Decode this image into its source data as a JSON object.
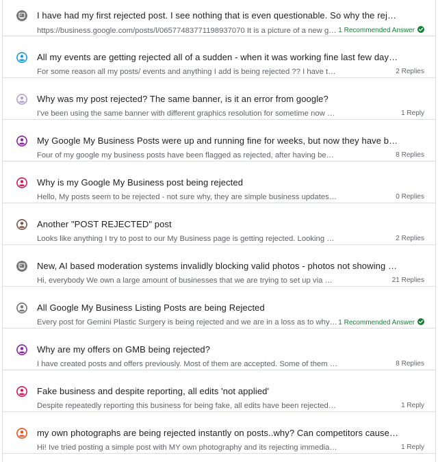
{
  "threads": [
    {
      "title": "I have had my first rejected post. I see nothing that is even questionable. So why the rejection?",
      "snippet": "https://business.google.com/posts/l/06577483771198937070 It is a picture of a new grill we offer at our restaurant",
      "meta": "1 Recommended Answer",
      "recommended": true,
      "avatar_color": "#757575",
      "avatar_type": "default"
    },
    {
      "title": "All my events are getting rejected all of a sudden - when it was working fine last few days ?? Why",
      "snippet": "For some reason all my posts/ events and anything I add is being rejected ?? I have tried many different things",
      "meta": "2 Replies",
      "recommended": false,
      "avatar_color": "#1a9ce0",
      "avatar_type": "person"
    },
    {
      "title": "Why was my post rejected? The same banner, is it an error from google?",
      "snippet": "I've been using the same banner with different graphics resolution for sometime now and size but it gets rejected",
      "meta": "1 Reply",
      "recommended": false,
      "avatar_color": "#b39ddb",
      "avatar_type": "person"
    },
    {
      "title": "My Google My Business Posts were up and running fine for weeks, but now they have been rejected",
      "snippet": "Four of my google my business posts have been flagged as rejected, after having been up for months now",
      "meta": "8 Replies",
      "recommended": false,
      "avatar_color": "#8e24aa",
      "avatar_type": "person"
    },
    {
      "title": "Why is my Google My Business post being rejected",
      "snippet": "Hello, My posts seem to be rejected - not sure why, they are simple business updates. Please help me understand",
      "meta": "0 Replies",
      "recommended": false,
      "avatar_color": "#d81b60",
      "avatar_type": "person"
    },
    {
      "title": "Another \"POST REJECTED\" post",
      "snippet": "Looks like anything I try to post to our My Business page is getting rejected. Looking at help on the subject",
      "meta": "2 Replies",
      "recommended": false,
      "avatar_color": "#795548",
      "avatar_type": "person"
    },
    {
      "title": "New, AI based moderation systems invalidly blocking valid photos - photos not showing up problem",
      "snippet": "Hi, everybody We own a large amount of businesses that we are trying to set up via Google and the photos",
      "meta": "21 Replies",
      "recommended": false,
      "avatar_color": "#757575",
      "avatar_type": "default"
    },
    {
      "title": "All Google My Business Listing Posts are being Rejected",
      "snippet": "Every post for Gemini Plastic Surgery is being rejected and we are in a loss as to why this is happening",
      "meta": "1 Recommended Answer",
      "recommended": true,
      "avatar_color": "#757575",
      "avatar_type": "person"
    },
    {
      "title": "Why are my offers on GMB being rejected?",
      "snippet": "I have created posts and offers previously. Most of them are accepted. Some of them get rejected without reason",
      "meta": "8 Replies",
      "recommended": false,
      "avatar_color": "#8e24aa",
      "avatar_type": "person"
    },
    {
      "title": "Fake business and despite reporting, all edits 'not applied'",
      "snippet": "Despite repeatedly reporting this business for being fake, all edits have been rejected. It seems that nothing works",
      "meta": "1 Reply",
      "recommended": false,
      "avatar_color": "#d81b60",
      "avatar_type": "person"
    },
    {
      "title": "my own photographs are being rejected instantly on posts..why? Can competitors cause this?",
      "snippet": "Hi! Ive tried posting a simple post with MY own photography and its rejecting immediately. Why?",
      "meta": "1 Reply",
      "recommended": false,
      "avatar_color": "#f4511e",
      "avatar_type": "person"
    }
  ]
}
